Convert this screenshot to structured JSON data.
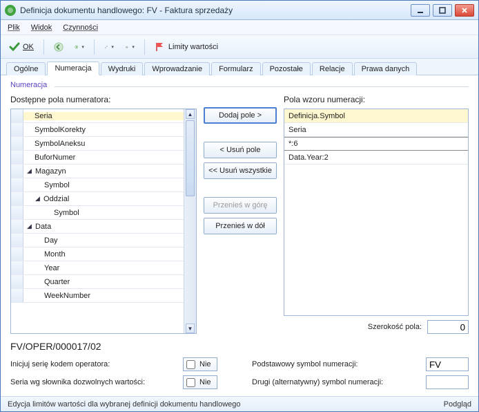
{
  "window": {
    "title": "Definicja dokumentu handlowego: FV - Faktura sprzedaży"
  },
  "menu": {
    "file": "Plik",
    "view": "Widok",
    "actions": "Czynności"
  },
  "toolbar": {
    "ok": "OK",
    "limits": "Limity wartości"
  },
  "tabs": {
    "items": [
      "Ogólne",
      "Numeracja",
      "Wydruki",
      "Wprowadzanie",
      "Formularz",
      "Pozostałe",
      "Relacje",
      "Prawa danych"
    ],
    "active": 1
  },
  "fieldset": {
    "label": "Numeracja"
  },
  "left": {
    "title": "Dostępne pola numeratora:",
    "rows": [
      {
        "label": "Seria",
        "indent": 1,
        "selected": true
      },
      {
        "label": "SymbolKorekty",
        "indent": 1
      },
      {
        "label": "SymbolAneksu",
        "indent": 1
      },
      {
        "label": "BuforNumer",
        "indent": 1
      },
      {
        "label": "Magazyn",
        "indent": 0,
        "exp": true
      },
      {
        "label": "Symbol",
        "indent": 2
      },
      {
        "label": "Oddzial",
        "indent": 1,
        "exp": true
      },
      {
        "label": "Symbol",
        "indent": 3
      },
      {
        "label": "Data",
        "indent": 0,
        "exp": true
      },
      {
        "label": "Day",
        "indent": 2
      },
      {
        "label": "Month",
        "indent": 2
      },
      {
        "label": "Year",
        "indent": 2
      },
      {
        "label": "Quarter",
        "indent": 2
      },
      {
        "label": "WeekNumber",
        "indent": 2
      }
    ]
  },
  "mid": {
    "add": "Dodaj pole >",
    "remove": "< Usuń pole",
    "removeAll": "<< Usuń wszystkie",
    "moveUp": "Przenieś w górę",
    "moveDown": "Przenieś w dół"
  },
  "right": {
    "title": "Pola wzoru numeracji:",
    "rows": [
      {
        "label": "Definicja.Symbol",
        "hl": true
      },
      {
        "label": "Seria"
      },
      {
        "label": "*:6",
        "whiteband": true
      },
      {
        "label": "Data.Year:2"
      }
    ],
    "widthLabel": "Szerokość pola:",
    "widthValue": "0"
  },
  "preview": "FV/OPER/000017/02",
  "form": {
    "initLabel": "Inicjuj serię kodem operatora:",
    "dictLabel": "Seria wg słownika dozwolnych wartości:",
    "no": "Nie",
    "primarySymLabel": "Podstawowy symbol numeracji:",
    "primarySymValue": "FV",
    "altSymLabel": "Drugi (alternatywny) symbol numeracji:",
    "altSymValue": ""
  },
  "status": {
    "left": "Edycja limitów wartości dla wybranej definicji dokumentu handlowego",
    "right": "Podgląd"
  }
}
